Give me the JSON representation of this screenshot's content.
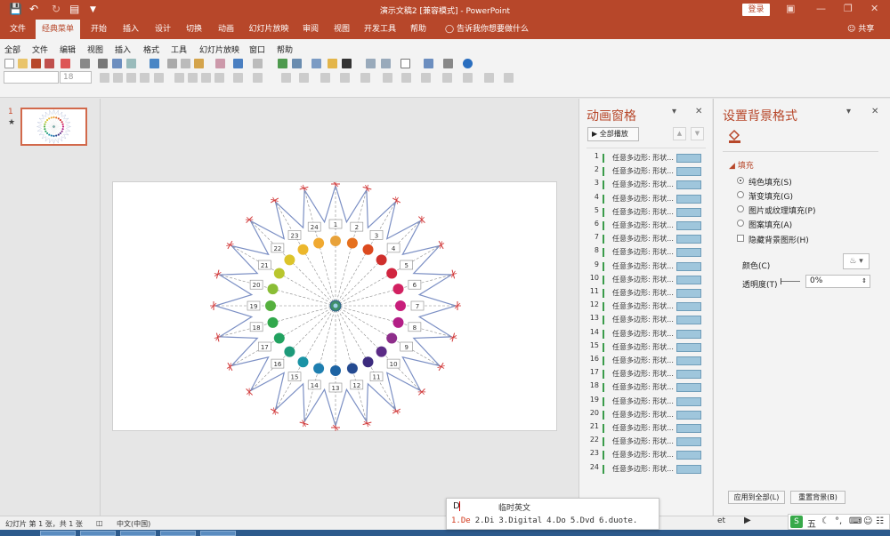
{
  "window": {
    "title": "演示文稿2 [兼容模式] - PowerPoint",
    "login_label": "登录",
    "quick_access_icons": [
      "save-icon",
      "undo-icon",
      "redo-icon",
      "slideshow-icon",
      "customize-icon"
    ]
  },
  "tabs": [
    {
      "label": "文件",
      "active": false
    },
    {
      "label": "经典菜单",
      "active": true
    },
    {
      "label": "开始",
      "active": false
    },
    {
      "label": "插入",
      "active": false
    },
    {
      "label": "设计",
      "active": false
    },
    {
      "label": "切换",
      "active": false
    },
    {
      "label": "动画",
      "active": false
    },
    {
      "label": "幻灯片放映",
      "active": false
    },
    {
      "label": "审阅",
      "active": false
    },
    {
      "label": "视图",
      "active": false
    },
    {
      "label": "开发工具",
      "active": false
    },
    {
      "label": "帮助",
      "active": false
    }
  ],
  "tell_me": "告诉我你想要做什么",
  "share": "共享",
  "classic_menu": [
    "全部",
    "文件",
    "编辑",
    "视图",
    "插入",
    "格式",
    "工具",
    "幻灯片放映",
    "窗口",
    "帮助"
  ],
  "font_size": "18",
  "thumbnails": {
    "number": "1",
    "star": "★"
  },
  "animation_pane": {
    "title": "动画窗格",
    "play_all": "全部播放",
    "items": [
      {
        "n": "1",
        "label": "任意多边形: 形状..."
      },
      {
        "n": "2",
        "label": "任意多边形: 形状..."
      },
      {
        "n": "3",
        "label": "任意多边形: 形状..."
      },
      {
        "n": "4",
        "label": "任意多边形: 形状..."
      },
      {
        "n": "5",
        "label": "任意多边形: 形状..."
      },
      {
        "n": "6",
        "label": "任意多边形: 形状..."
      },
      {
        "n": "7",
        "label": "任意多边形: 形状..."
      },
      {
        "n": "8",
        "label": "任意多边形: 形状..."
      },
      {
        "n": "9",
        "label": "任意多边形: 形状..."
      },
      {
        "n": "10",
        "label": "任意多边形: 形状..."
      },
      {
        "n": "11",
        "label": "任意多边形: 形状..."
      },
      {
        "n": "12",
        "label": "任意多边形: 形状..."
      },
      {
        "n": "13",
        "label": "任意多边形: 形状..."
      },
      {
        "n": "14",
        "label": "任意多边形: 形状..."
      },
      {
        "n": "15",
        "label": "任意多边形: 形状..."
      },
      {
        "n": "16",
        "label": "任意多边形: 形状..."
      },
      {
        "n": "17",
        "label": "任意多边形: 形状..."
      },
      {
        "n": "18",
        "label": "任意多边形: 形状..."
      },
      {
        "n": "19",
        "label": "任意多边形: 形状..."
      },
      {
        "n": "20",
        "label": "任意多边形: 形状..."
      },
      {
        "n": "21",
        "label": "任意多边形: 形状..."
      },
      {
        "n": "22",
        "label": "任意多边形: 形状..."
      },
      {
        "n": "23",
        "label": "任意多边形: 形状..."
      },
      {
        "n": "24",
        "label": "任意多边形: 形状..."
      }
    ]
  },
  "format_background": {
    "title": "设置背景格式",
    "section": "填充",
    "options": [
      {
        "label": "纯色填充(S)",
        "type": "radio",
        "selected": true
      },
      {
        "label": "渐变填充(G)",
        "type": "radio",
        "selected": false
      },
      {
        "label": "图片或纹理填充(P)",
        "type": "radio",
        "selected": false
      },
      {
        "label": "图案填充(A)",
        "type": "radio",
        "selected": false
      },
      {
        "label": "隐藏背景图形(H)",
        "type": "checkbox",
        "selected": false
      }
    ],
    "color_label": "颜色(C)",
    "transparency_label": "透明度(T)",
    "transparency_value": "0%",
    "apply_all": "应用到全部(L)",
    "reset_background": "重置背景(B)"
  },
  "slide": {
    "marker_labels": [
      "1",
      "2",
      "3",
      "4",
      "5",
      "6",
      "7",
      "8",
      "9",
      "10",
      "11",
      "12",
      "13",
      "14",
      "15",
      "16",
      "17",
      "18",
      "19",
      "20",
      "21",
      "22",
      "23",
      "24"
    ],
    "dot_colors": [
      "#e8a23a",
      "#e5701e",
      "#dc4a1f",
      "#cf2f2c",
      "#d1253f",
      "#d22161",
      "#c81e7b",
      "#b31e86",
      "#8e2e8b",
      "#5b2b86",
      "#3c2b7e",
      "#244a91",
      "#1d63a3",
      "#1f7fb0",
      "#1a93a5",
      "#1d9a7a",
      "#22a260",
      "#31a84c",
      "#55b03e",
      "#8abd36",
      "#b9c62e",
      "#dcc42a",
      "#ecb72c",
      "#f0a931"
    ]
  },
  "status": {
    "slide_info": "幻灯片 第 1 张，共 1 张",
    "language": "中文(中国)"
  },
  "ime": {
    "composition": "D",
    "mode_label": "临时英文",
    "candidates": [
      "1.De",
      "2.Di",
      "3.Digital",
      "4.Do",
      "5.Dvd",
      "6.duote."
    ]
  },
  "tray": {
    "sogou": "S",
    "five": "五",
    "overlay_text": "et"
  },
  "colors": {
    "accent": "#b7472a",
    "ribbon_bg": "#f3f3f3",
    "anim_bar": "#9fc6dc"
  }
}
